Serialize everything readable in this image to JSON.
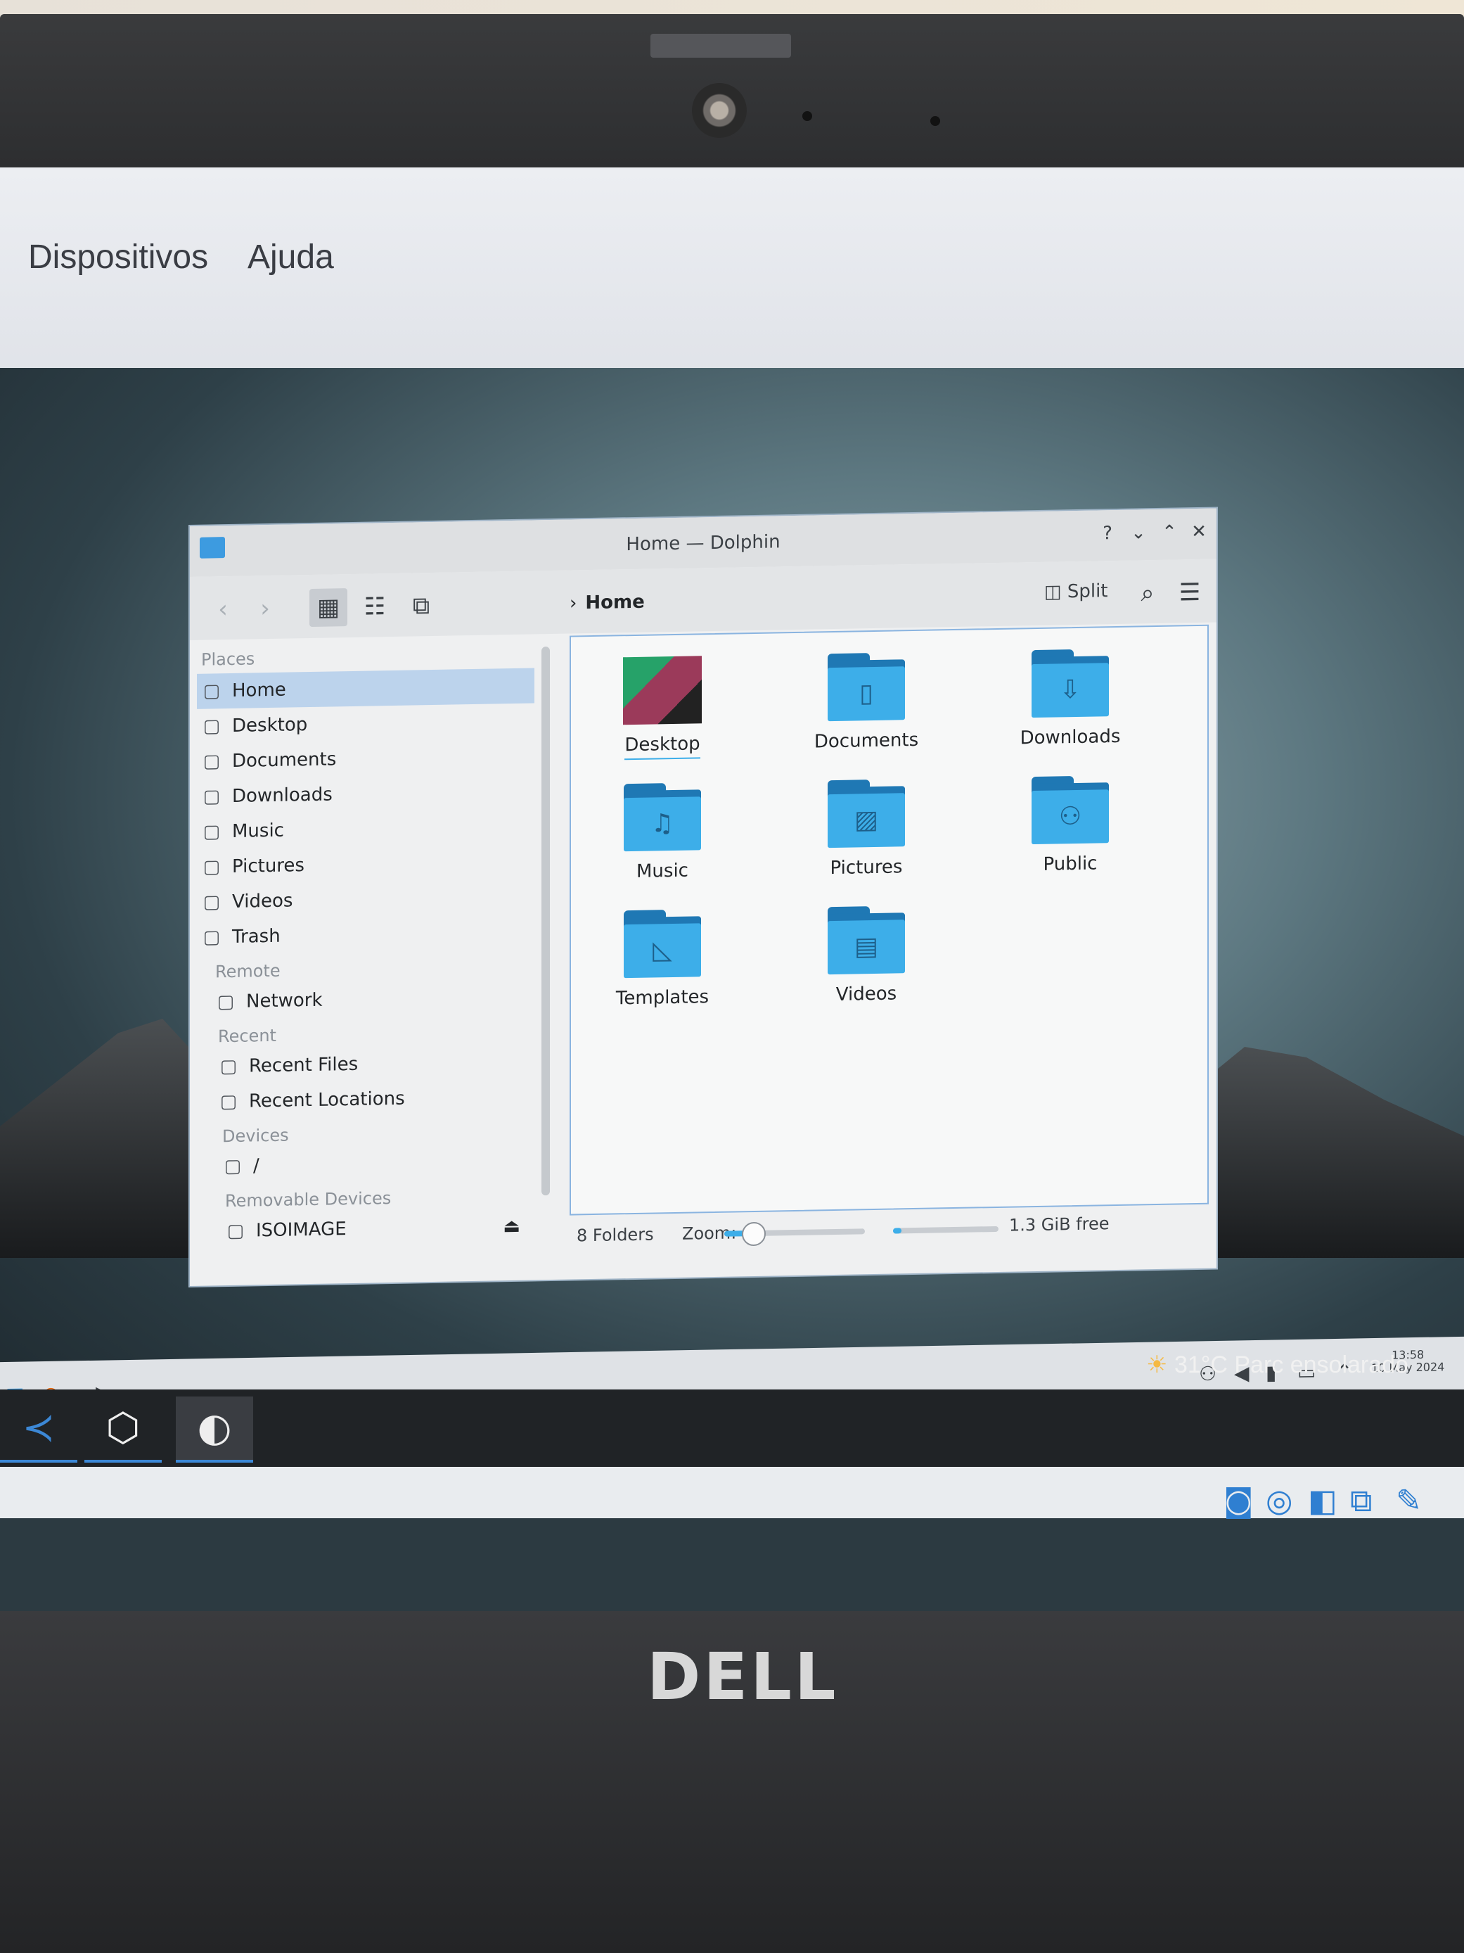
{
  "vbox_menu": {
    "items": [
      "Dispositivos",
      "Ajuda"
    ]
  },
  "window": {
    "title": "Home — Dolphin",
    "controls": [
      "?",
      "⌄",
      "⌃",
      "✕"
    ],
    "breadcrumb": "Home",
    "split_label": "Split"
  },
  "sidebar": {
    "places_label": "Places",
    "places": [
      {
        "label": "Home",
        "icon": "home-icon",
        "selected": true
      },
      {
        "label": "Desktop",
        "icon": "desktop-icon"
      },
      {
        "label": "Documents",
        "icon": "documents-icon"
      },
      {
        "label": "Downloads",
        "icon": "downloads-icon"
      },
      {
        "label": "Music",
        "icon": "music-icon"
      },
      {
        "label": "Pictures",
        "icon": "pictures-icon"
      },
      {
        "label": "Videos",
        "icon": "videos-icon"
      },
      {
        "label": "Trash",
        "icon": "trash-icon"
      }
    ],
    "remote_label": "Remote",
    "remote": [
      {
        "label": "Network",
        "icon": "network-icon"
      }
    ],
    "recent_label": "Recent",
    "recent": [
      {
        "label": "Recent Files",
        "icon": "recent-files-icon"
      },
      {
        "label": "Recent Locations",
        "icon": "recent-locations-icon"
      }
    ],
    "devices_label": "Devices",
    "devices": [
      {
        "label": "/",
        "icon": "drive-icon"
      }
    ],
    "removable_label": "Removable Devices",
    "removable": [
      {
        "label": "ISOIMAGE",
        "icon": "optical-disc-icon"
      }
    ]
  },
  "files": [
    {
      "name": "Desktop",
      "icon": "wallpaper-thumb"
    },
    {
      "name": "Documents",
      "icon": "documents-folder-icon"
    },
    {
      "name": "Downloads",
      "icon": "downloads-folder-icon"
    },
    {
      "name": "Music",
      "icon": "music-folder-icon"
    },
    {
      "name": "Pictures",
      "icon": "pictures-folder-icon"
    },
    {
      "name": "Public",
      "icon": "public-folder-icon"
    },
    {
      "name": "Templates",
      "icon": "templates-folder-icon"
    },
    {
      "name": "Videos",
      "icon": "videos-folder-icon"
    }
  ],
  "status": {
    "count": "8 Folders",
    "zoom_label": "Zoom:",
    "zoom_fraction": 0.2,
    "free_label": "1.3 GiB free",
    "used_fraction": 0.08
  },
  "kde_panel": {
    "time": "13:58",
    "date": "10 May 2024"
  },
  "host": {
    "weather_temp": "31°C",
    "weather_text": "Parc ensolarado"
  },
  "brand": "DELL",
  "colors": {
    "accent": "#3daee9",
    "folder_dark": "#1f78b4",
    "selection": "#bcd3ec"
  }
}
